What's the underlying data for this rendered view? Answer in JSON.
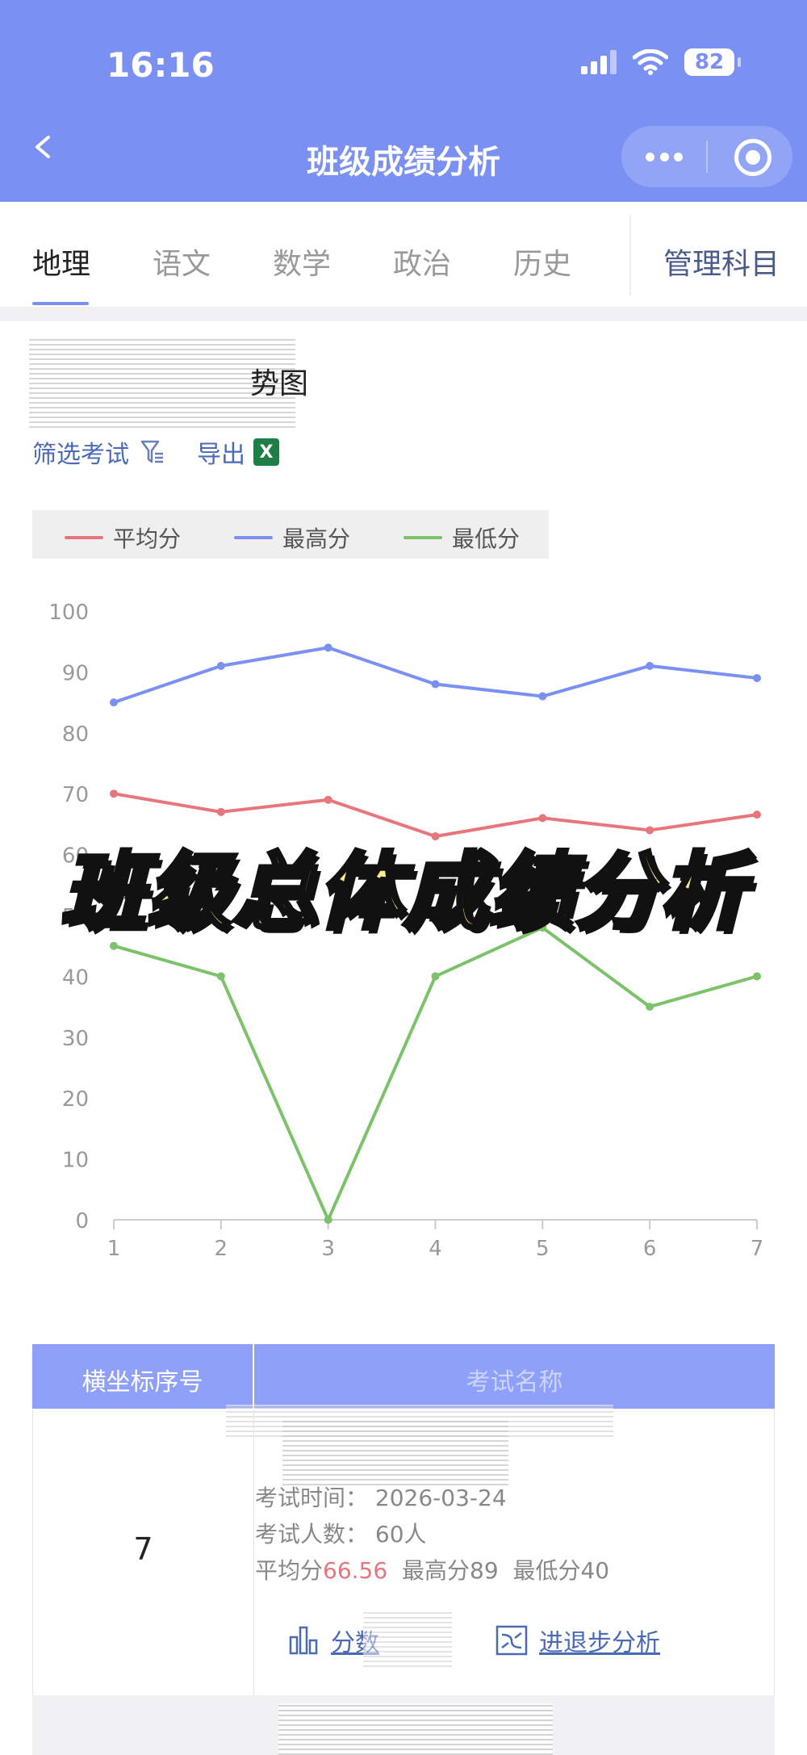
{
  "status_bar": {
    "time": "16:16",
    "battery": "82"
  },
  "nav": {
    "title": "班级成绩分析"
  },
  "tabs": [
    {
      "label": "地理",
      "active": true
    },
    {
      "label": "语文",
      "active": false
    },
    {
      "label": "数学",
      "active": false
    },
    {
      "label": "政治",
      "active": false
    },
    {
      "label": "历史",
      "active": false
    }
  ],
  "manage_subjects": "管理科目",
  "section": {
    "title_visible": "势图",
    "filter_label": "筛选考试",
    "export_label": "导出",
    "excel_icon": "X"
  },
  "overlay": {
    "title": "班级总体成绩分析"
  },
  "colors": {
    "header": "#7b90f3",
    "avg": "#e8747c",
    "max": "#7b90f3",
    "min": "#7cc26a"
  },
  "chart_data": {
    "type": "line",
    "x": [
      1,
      2,
      3,
      4,
      5,
      6,
      7
    ],
    "ylim": [
      0,
      100
    ],
    "yticks": [
      0,
      10,
      20,
      30,
      40,
      50,
      60,
      70,
      80,
      90,
      100
    ],
    "legend_position": "top-left",
    "grid": false,
    "series": [
      {
        "name": "平均分",
        "color": "#e8747c",
        "values": [
          70,
          67,
          69,
          63,
          66,
          64,
          66.56
        ]
      },
      {
        "name": "最高分",
        "color": "#7b90f3",
        "values": [
          85,
          91,
          94,
          88,
          86,
          91,
          89
        ]
      },
      {
        "name": "最低分",
        "color": "#7cc26a",
        "values": [
          45,
          40,
          0,
          40,
          48,
          35,
          40
        ]
      }
    ]
  },
  "table": {
    "col1_header": "横坐标序号",
    "col2_header": "考试名称",
    "row": {
      "index": "7",
      "time_label": "考试时间：",
      "time_value": "2026-03-24",
      "count_label": "考试人数：",
      "count_value": "60人",
      "avg_label": "平均分",
      "avg_value": "66.56",
      "max_label": "最高分",
      "max_value": "89",
      "min_label": "最低分",
      "min_value": "40",
      "score_link": "分数",
      "progress_link": "进退步分析"
    }
  }
}
